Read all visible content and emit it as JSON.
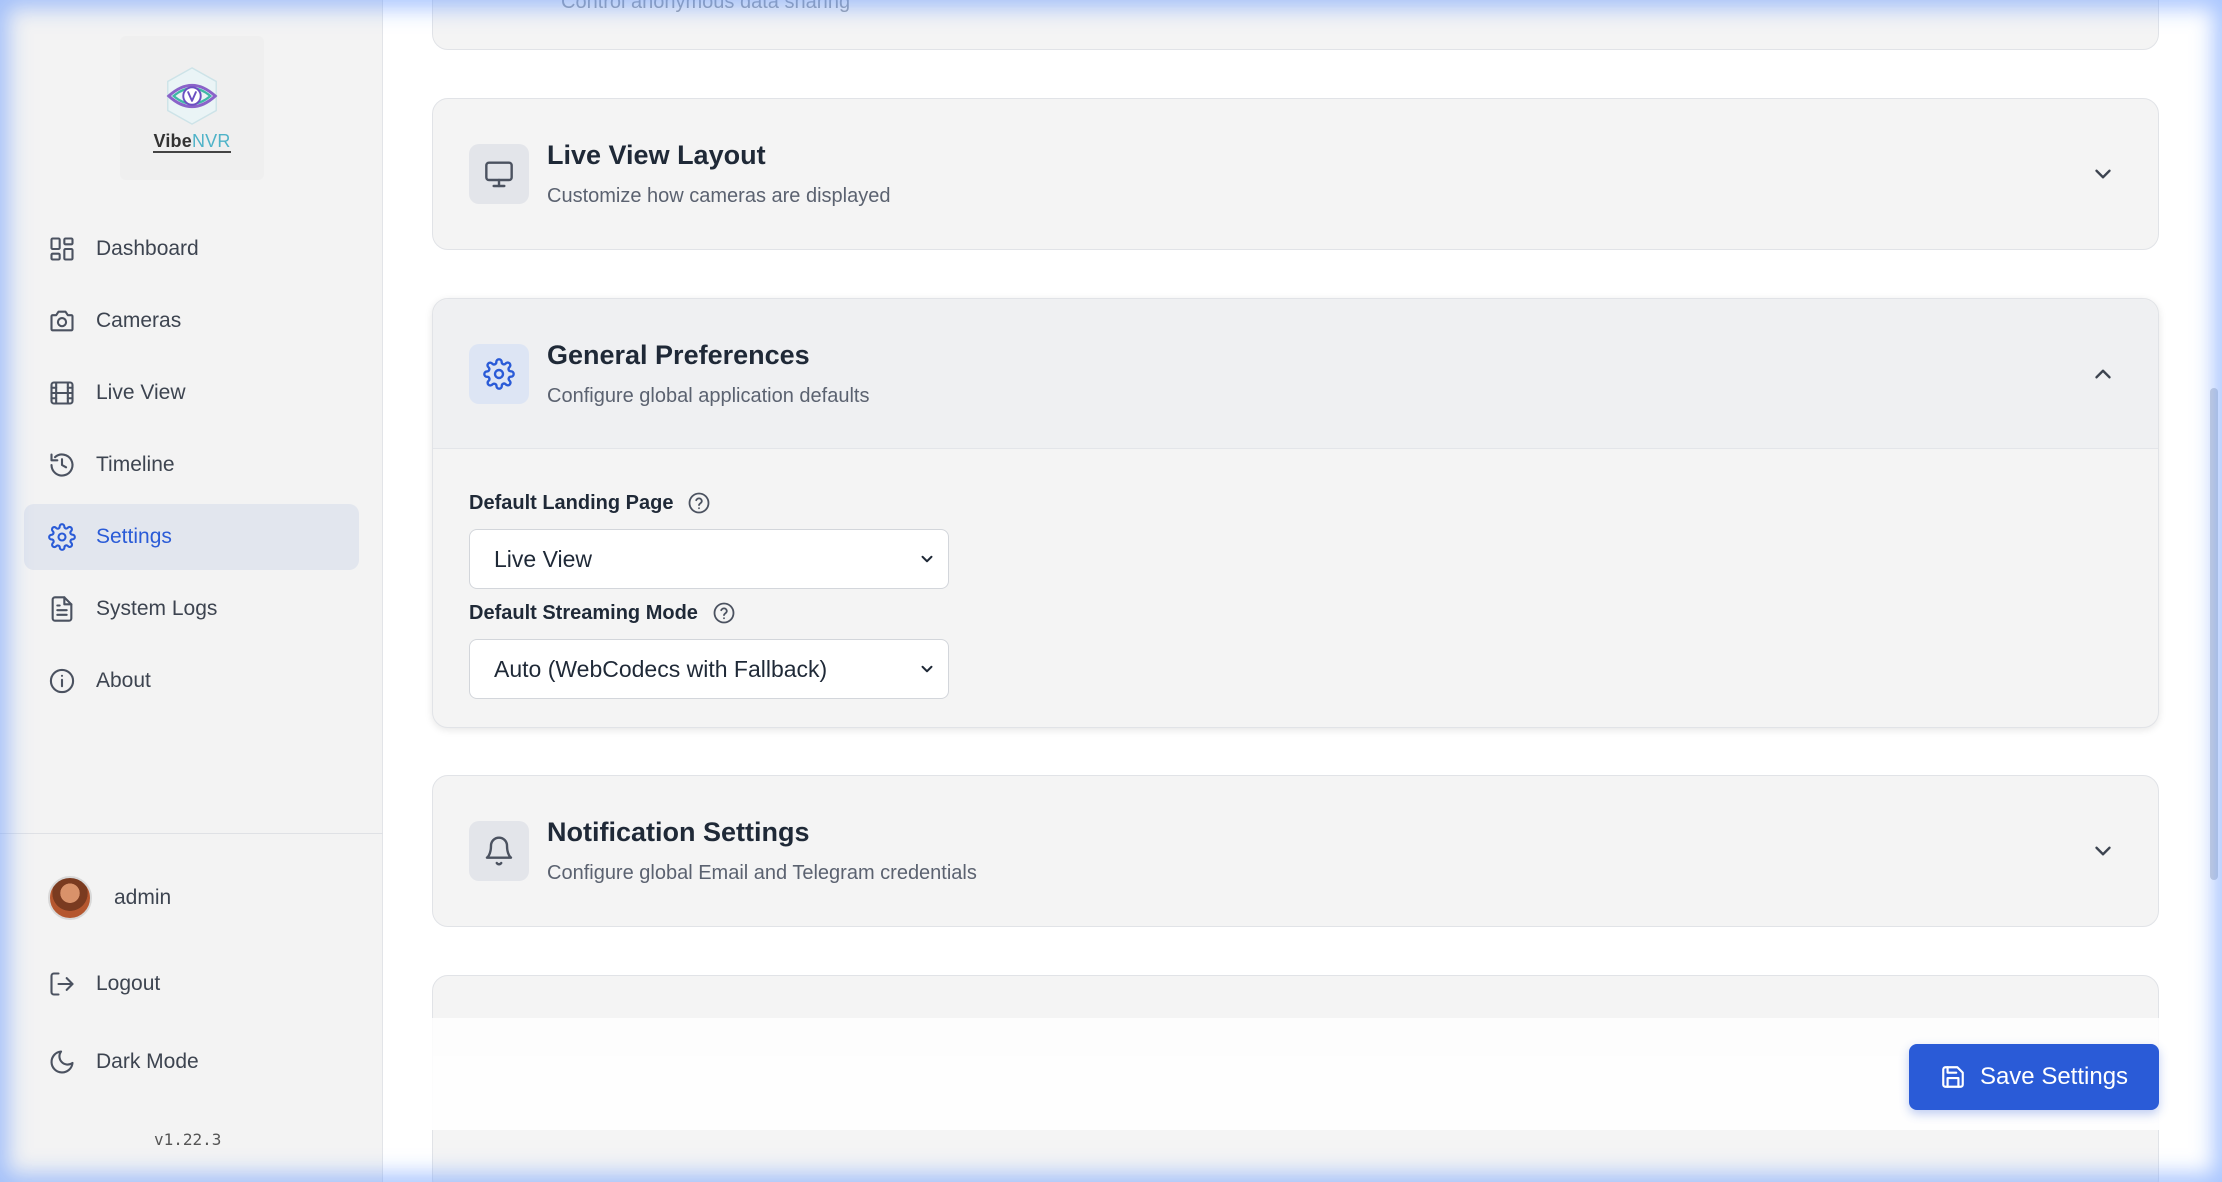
{
  "app": {
    "logo_text_main": "Vibe",
    "logo_text_accent": "NVR",
    "version": "v1.22.3"
  },
  "sidebar": {
    "items": [
      {
        "label": "Dashboard",
        "icon": "dashboard-icon",
        "active": false
      },
      {
        "label": "Cameras",
        "icon": "camera-icon",
        "active": false
      },
      {
        "label": "Live View",
        "icon": "film-icon",
        "active": false
      },
      {
        "label": "Timeline",
        "icon": "history-icon",
        "active": false
      },
      {
        "label": "Settings",
        "icon": "gear-icon",
        "active": true
      },
      {
        "label": "System Logs",
        "icon": "document-icon",
        "active": false
      },
      {
        "label": "About",
        "icon": "info-icon",
        "active": false
      }
    ],
    "user": {
      "name": "admin"
    },
    "logout_label": "Logout",
    "dark_mode_label": "Dark Mode"
  },
  "sections": {
    "privacy": {
      "subtitle": "Control anonymous data sharing"
    },
    "live_view_layout": {
      "title": "Live View Layout",
      "subtitle": "Customize how cameras are displayed",
      "icon": "monitor-icon",
      "expanded": false
    },
    "general_preferences": {
      "title": "General Preferences",
      "subtitle": "Configure global application defaults",
      "icon": "gear-icon",
      "expanded": true,
      "fields": {
        "landing_page": {
          "label": "Default Landing Page",
          "value": "Live View"
        },
        "streaming_mode": {
          "label": "Default Streaming Mode",
          "value": "Auto (WebCodecs with Fallback)"
        }
      }
    },
    "notifications": {
      "title": "Notification Settings",
      "subtitle": "Configure global Email and Telegram credentials",
      "icon": "bell-icon",
      "expanded": false
    }
  },
  "actions": {
    "save_label": "Save Settings"
  },
  "colors": {
    "accent": "#2a5bd7",
    "active_nav_bg": "#e2e6ee",
    "card_bg": "#f4f4f4"
  }
}
